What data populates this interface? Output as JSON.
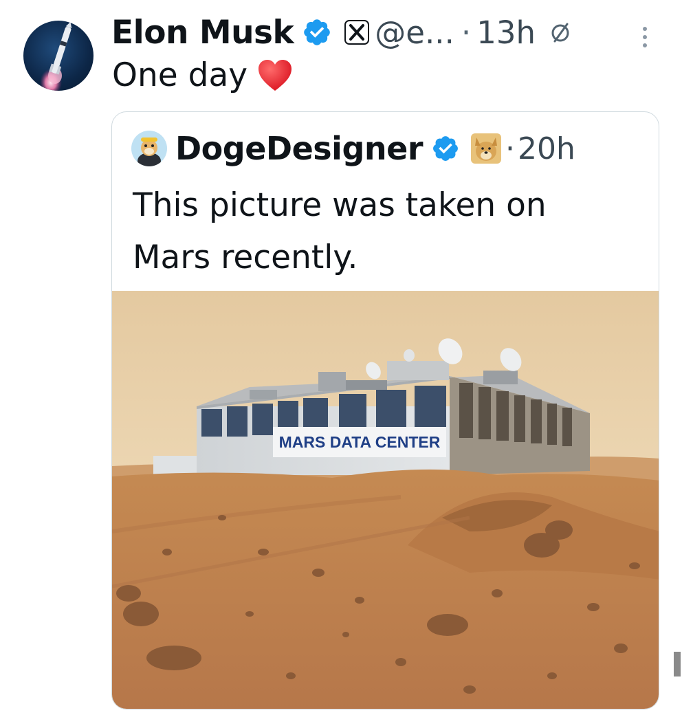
{
  "post": {
    "author": {
      "name": "Elon Musk",
      "handle": "@e...",
      "avatar_icon": "rocket-launch-avatar"
    },
    "separator": "·",
    "time": "13h",
    "text": "One day",
    "emoji_icon": "red-heart-icon",
    "verified_color": "#1d9bf0"
  },
  "quote": {
    "author": {
      "name": "DogeDesigner",
      "avatar_icon": "doge-avatar",
      "affiliate_icon": "doge-badge-icon"
    },
    "separator": "·",
    "time": "20h",
    "text_line1": "This picture was taken on",
    "text_line2": "Mars recently.",
    "image": {
      "sign_text": "MARS DATA CENTER",
      "sky_color": "#e6cfa6",
      "ground_color": "#c98a52"
    }
  }
}
